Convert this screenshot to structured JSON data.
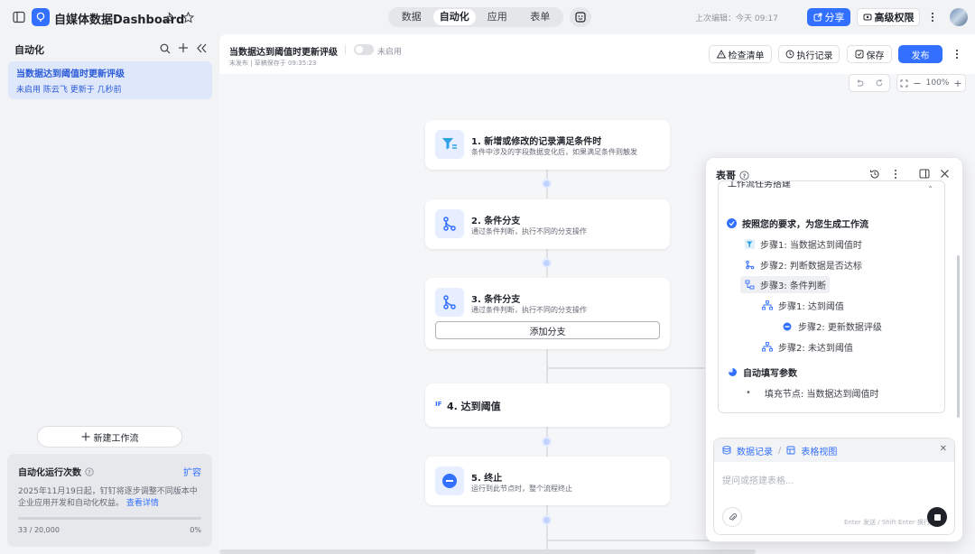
{
  "app": {
    "title": "自媒体数据Dashboard",
    "tabs": [
      "数据",
      "自动化",
      "应用",
      "表单"
    ],
    "active_tab": "自动化",
    "last_edit": "上次编辑：今天 09:17",
    "share_label": "分享",
    "perm_label": "高级权限"
  },
  "sidebar": {
    "title": "自动化",
    "workflow": {
      "name": "当数据达到阈值时更新评级",
      "meta": "未启用  陈云飞 更新于 几秒前"
    },
    "new_workflow": "新建工作流",
    "quota": {
      "title": "自动化运行次数",
      "expand": "扩容",
      "desc": "2025年11月19日起，钉钉将逐步调整不同版本中企业应用开发和自动化权益。",
      "link": "查看详情",
      "usage": "33 / 20,000",
      "percent": "0%",
      "fraction": 0.0
    }
  },
  "canvas": {
    "title": "当数据达到阈值时更新评级",
    "status": "未启用",
    "subtitle": "未发布 | 草稿保存于 09:35:23",
    "buttons": {
      "checklist": "检查清单",
      "history": "执行记录",
      "save": "保存",
      "publish": "发布"
    },
    "zoom": "100%",
    "nodes": [
      {
        "title": "1. 新增或修改的记录满足条件时",
        "desc": "条件中涉及的字段数据变化后，如果满足条件则触发"
      },
      {
        "title": "2. 条件分支",
        "desc": "通过条件判断，执行不同的分支操作"
      },
      {
        "title": "3. 条件分支",
        "desc": "通过条件判断，执行不同的分支操作",
        "action": "添加分支"
      },
      {
        "title": "4. 达到阈值",
        "badge": "IF"
      },
      {
        "title": "5. 终止",
        "desc": "运行到此节点时，整个流程终止"
      }
    ]
  },
  "assistant": {
    "title": "表哥",
    "section_header": "工作流任务搭建",
    "steps": [
      "按照您的要求，为您生成工作流",
      "步骤1: 当数据达到阈值时",
      "步骤2: 判断数据是否达标",
      "步骤3: 条件判断",
      "步骤1: 达到阈值",
      "步骤2: 更新数据评级",
      "步骤2: 未达到阈值",
      "自动填写参数",
      "填充节点: 当数据达到阈值时"
    ],
    "input": {
      "tab_records": "数据记录",
      "tab_sep": "/",
      "tab_view": "表格视图",
      "placeholder": "提问或搭建表格...",
      "hint": "Enter 发送 / Shift Enter 换行"
    }
  },
  "colors": {
    "accent": "#3370ff",
    "bg": "#f2f3f5"
  }
}
